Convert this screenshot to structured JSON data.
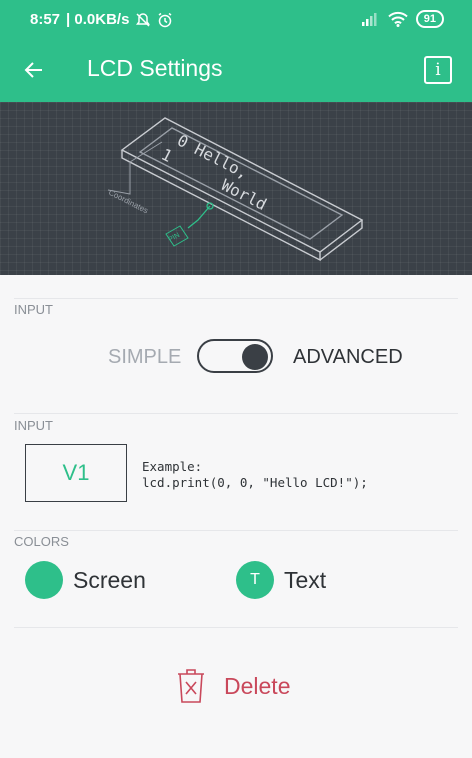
{
  "status_bar": {
    "time": "8:57",
    "network_speed": "| 0.0KB/s",
    "battery": "91",
    "icons": [
      "mute-bell-icon",
      "alarm-icon",
      "signal-icon",
      "wifi-icon",
      "battery-icon"
    ]
  },
  "app_bar": {
    "title": "LCD Settings",
    "back_icon": "back-arrow-icon",
    "info_icon": "info-icon",
    "info_glyph": "i"
  },
  "preview": {
    "lcd_line1": "0 Hello,",
    "lcd_line2": "1      World",
    "coordinates_label": "Coordinates",
    "pin_label": "PIN"
  },
  "mode_section": {
    "label": "INPUT",
    "simple_label": "SIMPLE",
    "advanced_label": "ADVANCED",
    "advanced_enabled": true
  },
  "input_section": {
    "label": "INPUT",
    "pin_value": "V1",
    "example_line1": "Example:",
    "example_line2": "lcd.print(0, 0, \"Hello LCD!\");"
  },
  "colors_section": {
    "label": "COLORS",
    "screen_label": "Screen",
    "text_label": "Text",
    "text_swatch_glyph": "T",
    "accent_color": "#2ebf8a"
  },
  "delete": {
    "label": "Delete",
    "color": "#c9485b"
  }
}
